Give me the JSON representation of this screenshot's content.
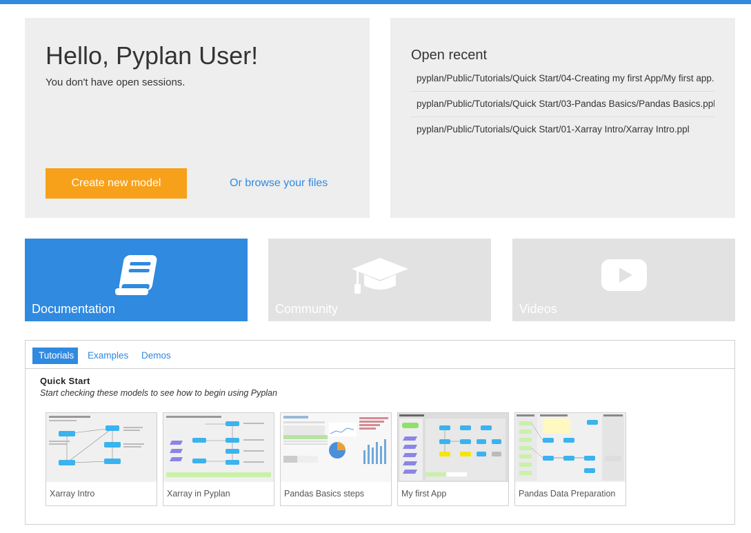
{
  "welcome": {
    "greeting": "Hello, Pyplan User!",
    "sessions_text": "You don't have open sessions.",
    "create_button": "Create new model",
    "browse_link": "Or browse your files"
  },
  "recent": {
    "title": "Open recent",
    "items": [
      "pyplan/Public/Tutorials/Quick Start/04-Creating my first App/My first app.p",
      "pyplan/Public/Tutorials/Quick Start/03-Pandas Basics/Pandas Basics.ppl",
      "pyplan/Public/Tutorials/Quick Start/01-Xarray Intro/Xarray Intro.ppl"
    ]
  },
  "tiles": [
    {
      "label": "Documentation",
      "icon": "book-icon",
      "active": true
    },
    {
      "label": "Community",
      "icon": "graduation-cap-icon",
      "active": false
    },
    {
      "label": "Videos",
      "icon": "play-icon",
      "active": false
    }
  ],
  "tabs": [
    "Tutorials",
    "Examples",
    "Demos"
  ],
  "active_tab": "Tutorials",
  "section": {
    "title": "Quick Start",
    "subtitle": "Start checking these models to see how to begin using Pyplan"
  },
  "cards": [
    "Xarray Intro",
    "Xarray in Pyplan",
    "Pandas Basics steps",
    "My first App",
    "Pandas Data Preparation"
  ],
  "colors": {
    "accent": "#2f8ae0",
    "create_button": "#f7a11a",
    "panel": "#eeeeee",
    "tile_inactive": "#e2e2e2"
  }
}
